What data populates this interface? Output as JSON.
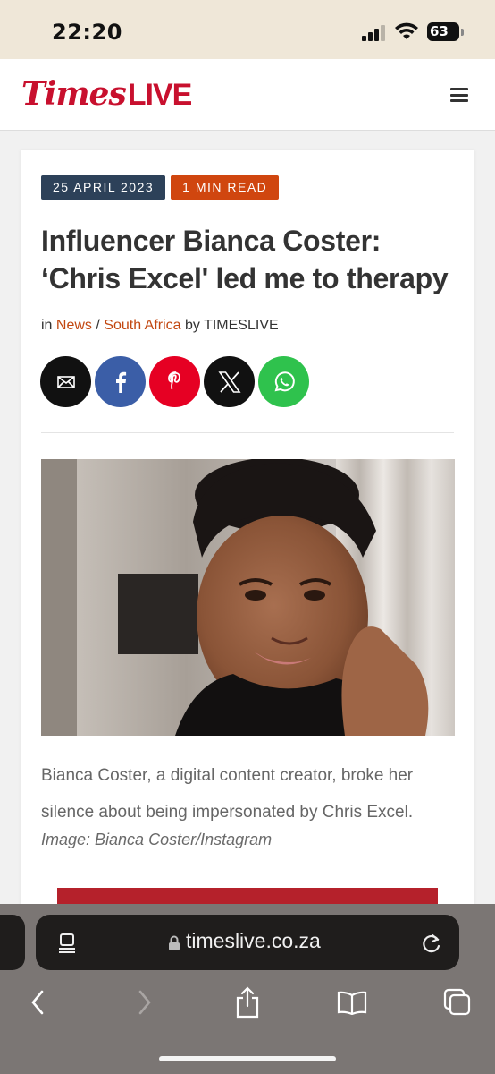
{
  "status_bar": {
    "time": "22:20",
    "battery": "63"
  },
  "header": {
    "logo_times": "Times",
    "logo_live": "LIVE",
    "menu_label": "menu"
  },
  "article": {
    "date_tag": "25 APRIL 2023",
    "read_tag": "1 MIN READ",
    "headline": "Influencer Bianca Coster: ‘Chris Excel' led me to therapy",
    "byline": {
      "in": "in",
      "section": "News",
      "sep": "/",
      "subsection": "South Africa",
      "by": "by",
      "author": "TIMESLIVE"
    },
    "share": [
      "email-icon",
      "facebook-icon",
      "pinterest-icon",
      "x-icon",
      "whatsapp-icon"
    ],
    "caption": "Bianca Coster, a digital content creator, broke her silence about being impersonated by Chris Excel.",
    "credit": "Image: Bianca Coster/Instagram"
  },
  "browser": {
    "url": "timeslive.co.za"
  },
  "colors": {
    "brand_red": "#c8102e",
    "date_tag": "#2d4159",
    "read_tag": "#d0460f",
    "link": "#c24710"
  }
}
